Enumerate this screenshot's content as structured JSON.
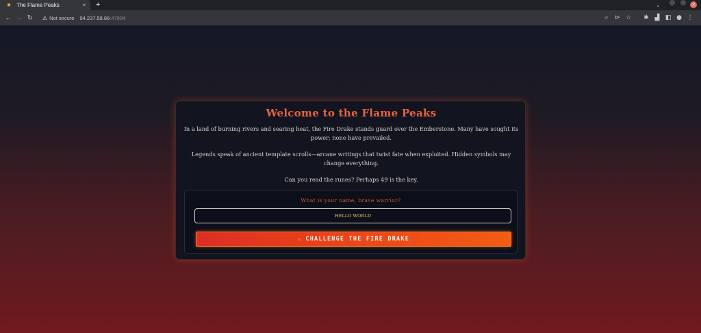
{
  "browser": {
    "tab_title": "The Flame Peaks",
    "tab_close": "×",
    "new_tab": "+",
    "security_label": "Not secure",
    "url_host": "94.237.58.86",
    "url_port": ":47904",
    "icons": [
      "search-icon",
      "send-tab-icon",
      "star-icon",
      "extensions-icon",
      "profile-icon",
      "menu-icon"
    ]
  },
  "page": {
    "title": "Welcome to the Flame Peaks",
    "intro": "In a land of burning rivers and searing heat, the Fire Drake stands guard over the Emberstone. Many have sought its power; none have prevailed.",
    "legend": "Legends speak of ancient template scrolls—arcane writings that twist fate when exploited. Hidden symbols may change everything.",
    "hint": "Can you read the runes? Perhaps 49 is the key.",
    "form": {
      "prompt": "What is your name, brave warrior?",
      "name_value": "HELLO WORLD",
      "button_label": "CHALLENGE THE FIRE DRAKE"
    }
  },
  "colors": {
    "accent": "#e8623c",
    "button_start": "#dd2f22",
    "button_end": "#f25c14"
  }
}
